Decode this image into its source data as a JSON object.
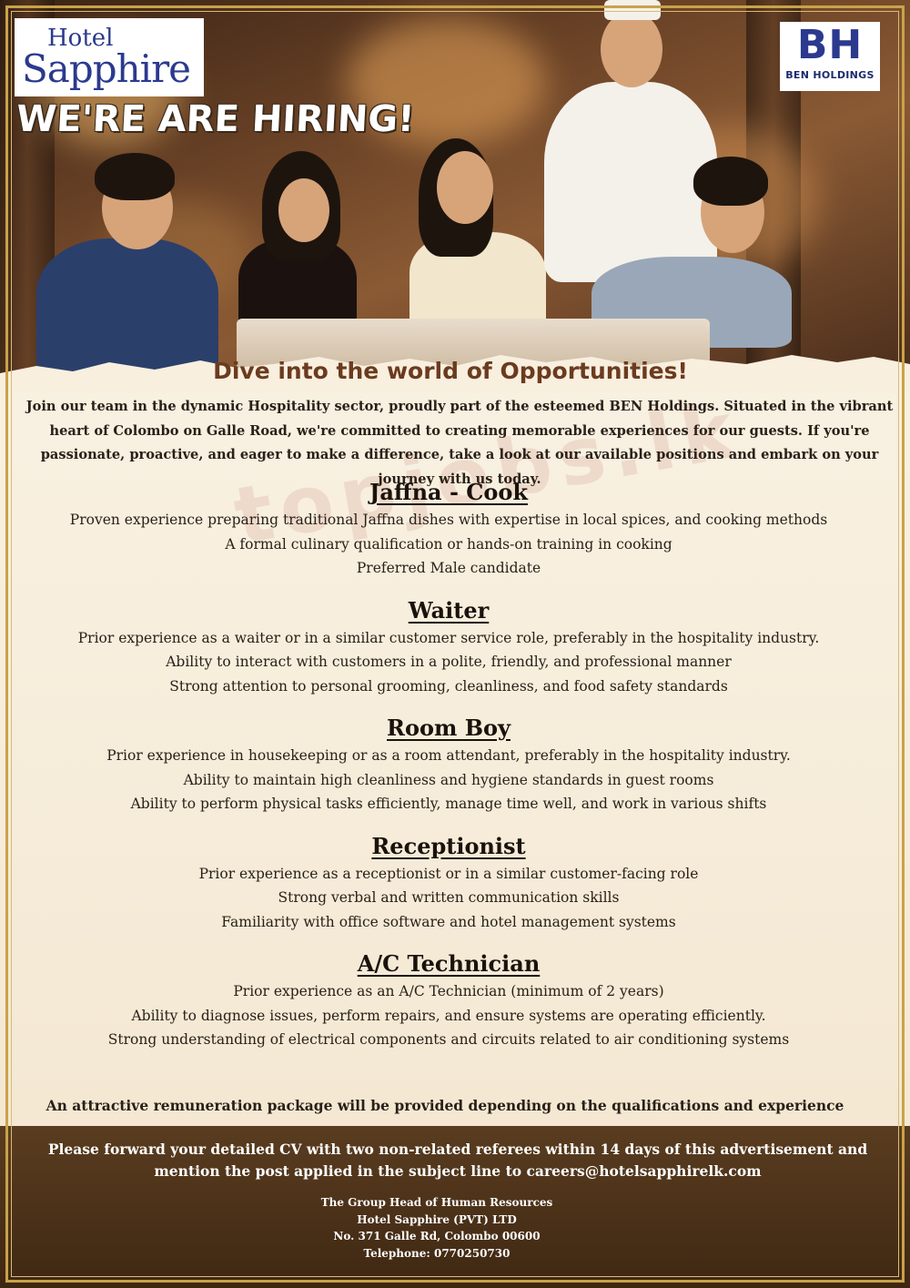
{
  "brand": {
    "hotel_logo_line1": "Hotel",
    "hotel_logo_line2": "Sapphire",
    "group_logo_mark": "BH",
    "group_logo_label": "BEN HOLDINGS"
  },
  "headline": "WE'RE ARE HIRING!",
  "subtitle": "Dive into the world of Opportunities!",
  "intro": "Join our team in the dynamic Hospitality sector, proudly part of the esteemed BEN Holdings. Situated in the vibrant heart of Colombo on Galle Road, we're committed to creating memorable experiences for our guests. If you're passionate, proactive, and eager to make a difference, take a look at our available positions and embark on your journey with us today.",
  "watermark": "topjobs.lk",
  "jobs": [
    {
      "title": "Jaffna - Cook",
      "requirements": [
        "Proven experience preparing traditional Jaffna dishes with expertise in local spices, and cooking methods",
        "A formal culinary qualification or hands-on training in cooking",
        "Preferred Male candidate"
      ]
    },
    {
      "title": "Waiter",
      "requirements": [
        "Prior experience as a waiter or in a similar customer service role, preferably in the hospitality industry.",
        "Ability to interact with customers in a polite, friendly, and professional manner",
        "Strong attention to personal grooming, cleanliness, and food safety standards"
      ]
    },
    {
      "title": "Room Boy",
      "requirements": [
        "Prior experience in housekeeping or as a room attendant, preferably in the hospitality industry.",
        "Ability to maintain high cleanliness and hygiene standards in guest rooms",
        "Ability to perform physical tasks efficiently, manage time well, and work in various shifts"
      ]
    },
    {
      "title": "Receptionist",
      "requirements": [
        "Prior experience as a receptionist or in a similar customer-facing role",
        "Strong verbal and written communication skills",
        "Familiarity with office software and hotel management systems"
      ]
    },
    {
      "title": "A/C Technician",
      "requirements": [
        "Prior experience as an A/C Technician (minimum of 2 years)",
        "Ability to diagnose issues, perform repairs, and ensure systems are operating efficiently.",
        "Strong understanding of electrical components and circuits related to air conditioning systems"
      ]
    }
  ],
  "remuneration": "An attractive remuneration package will be provided depending on the qualifications and experience",
  "apply": "Please forward your detailed CV with two non-related referees within 14 days of this advertisement and mention the post applied in the subject line to careers@hotelsapphirelk.com",
  "contact": {
    "line1": "The Group Head of Human Resources",
    "line2": "Hotel Sapphire (PVT) LTD",
    "line3": "No. 371 Galle Rd, Colombo 00600",
    "line4": "Telephone: 0770250730"
  },
  "colors": {
    "brand_blue": "#2b3a8e",
    "accent_gold": "#c9a24a",
    "subtitle_brown": "#6b3b1f",
    "footer_brown": "#4a3018"
  }
}
